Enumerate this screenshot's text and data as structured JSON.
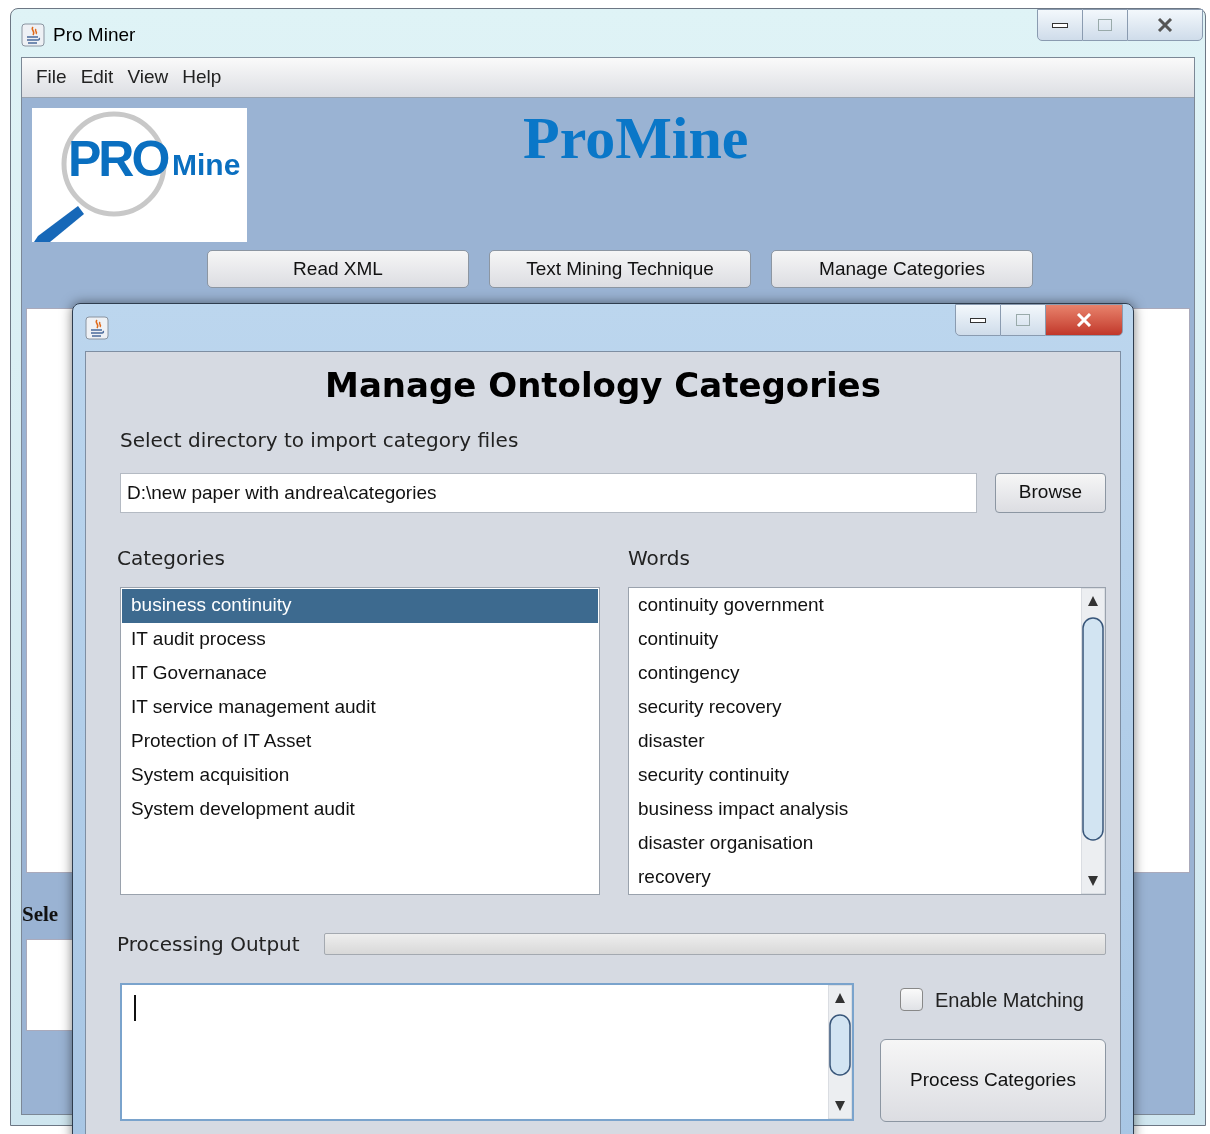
{
  "window": {
    "title": "Pro Miner"
  },
  "menu": [
    "File",
    "Edit",
    "View",
    "Help"
  ],
  "logo": {
    "text_1": "PRO",
    "text_2": "Mine"
  },
  "app_title": "ProMine",
  "toolbar_buttons": [
    "Read XML",
    "Text Mining Technique",
    "Manage Categories"
  ],
  "background_label": "Sele",
  "dialog": {
    "heading": "Manage Ontology Categories",
    "directory_label": "Select directory to import category files",
    "directory_value": "D:\\new paper with andrea\\categories",
    "browse_button": "Browse",
    "categories_label": "Categories",
    "words_label": "Words",
    "categories": [
      {
        "label": "business continuity",
        "selected": true
      },
      {
        "label": "IT audit process",
        "selected": false
      },
      {
        "label": "IT Governanace",
        "selected": false
      },
      {
        "label": "IT service management audit",
        "selected": false
      },
      {
        "label": "Protection of IT Asset",
        "selected": false
      },
      {
        "label": "System acquisition",
        "selected": false
      },
      {
        "label": "System development audit",
        "selected": false
      }
    ],
    "words": [
      "continuity government",
      "continuity",
      "contingency",
      "security recovery",
      "disaster",
      "security continuity",
      "business impact analysis",
      "disaster organisation",
      "recovery"
    ],
    "output_label": "Processing Output",
    "progress": {
      "level": 0
    },
    "enable_matching": {
      "label": "Enable Matching",
      "checked": false
    },
    "process_button": "Process Categories"
  }
}
